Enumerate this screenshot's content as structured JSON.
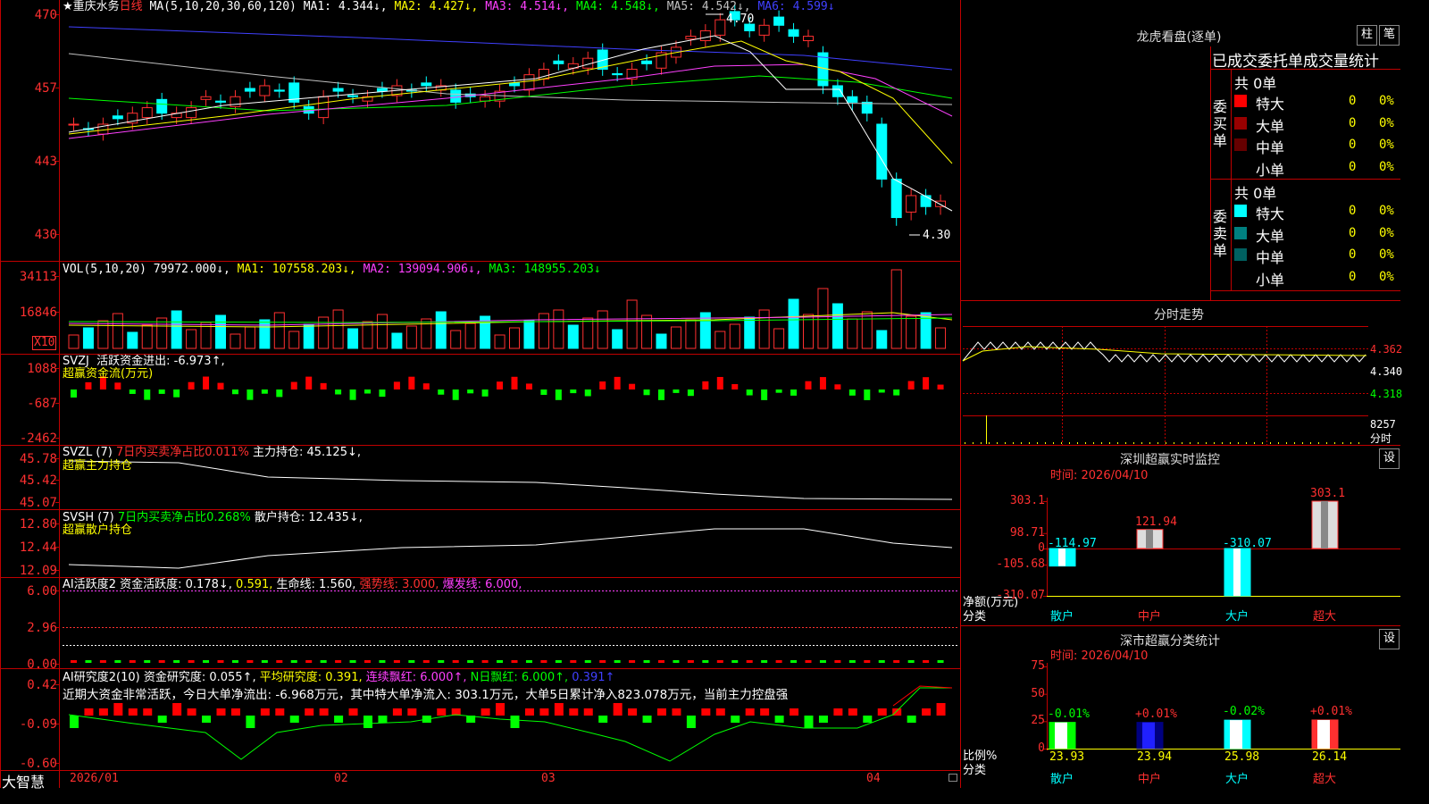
{
  "stock": {
    "title": "★重庆水务",
    "period": "日线"
  },
  "main": {
    "ma_params": "MA(5,10,20,30,60,120)",
    "ma": [
      {
        "label": "MA1: 4.344↓,",
        "color": "#ffffff"
      },
      {
        "label": "MA2: 4.427↓,",
        "color": "#ffff00"
      },
      {
        "label": "MA3: 4.514↓,",
        "color": "#ff40ff"
      },
      {
        "label": "MA4: 4.548↓,",
        "color": "#00ff00"
      },
      {
        "label": "MA5: 4.542↓,",
        "color": "#c0c0c0"
      },
      {
        "label": "MA6: 4.599↓",
        "color": "#4040ff"
      }
    ],
    "y_labels": [
      "470",
      "457",
      "443",
      "430"
    ],
    "high_note": "4.70",
    "low_note": "4.30"
  },
  "vol": {
    "header": "VOL(5,10,20)",
    "value": "79972.000↓,",
    "ma1": "MA1: 107558.203↓,",
    "ma2": "MA2: 139094.906↓,",
    "ma3": "MA3: 148955.203↓",
    "y_labels": [
      "34113",
      "16846"
    ],
    "unit": "X10"
  },
  "svzj": {
    "header": "SVZJ",
    "label": "活跃资金进出: -6.973↑,",
    "sub": "超赢资金流(万元)",
    "y_labels": [
      "1088",
      "-687",
      "-2462"
    ]
  },
  "svzl": {
    "header": "SVZL (7)",
    "label1": "7日内买卖净占比0.011%",
    "label2": "主力持仓: 45.125↓,",
    "sub": "超赢主力持仓",
    "y_labels": [
      "45.78",
      "45.42",
      "45.07"
    ]
  },
  "svsh": {
    "header": "SVSH (7)",
    "label1": "7日内买卖净占比0.268%",
    "label2": "散户持仓: 12.435↓,",
    "sub": "超赢散户持仓",
    "y_labels": [
      "12.80",
      "12.44",
      "12.09"
    ]
  },
  "ai1": {
    "header": "AI活跃度2",
    "a": "资金活跃度: 0.178↓,",
    "b": "0.591,",
    "c": "生命线: 1.560,",
    "d": "强势线: 3.000,",
    "e": "爆发线: 6.000,",
    "y_labels": [
      "6.00",
      "2.96",
      "0.00"
    ]
  },
  "ai2": {
    "header": "AI研究度2(10)",
    "a": "资金研究度: 0.055↑,",
    "b": "平均研究度: 0.391,",
    "c": "连续飘红: 6.000↑,",
    "d": "N日飘红: 6.000↑,",
    "e": "0.391↑",
    "comment": "近期大资金非常活跃，今日大单净流出: -6.968万元，其中特大单净流入: 303.1万元，大单5日累计净入823.078万元，当前主力控盘强",
    "y_labels": [
      "0.42",
      "-0.09",
      "-0.60"
    ]
  },
  "footer": {
    "brand": "大智慧",
    "dates": [
      "2026/01",
      "02",
      "03",
      "04"
    ]
  },
  "dragon": {
    "title": "龙虎看盘(逐单)",
    "btn1": "柱",
    "btn2": "笔",
    "subtitle": "已成交委托单成交量统计",
    "buy_total": "共 0单",
    "sell_total": "共 0单",
    "buy_label": "委买单",
    "sell_label": "委卖单",
    "buy_rows": [
      {
        "name": "特大",
        "count": "0",
        "pct": "0%",
        "color": "#ff0000"
      },
      {
        "name": "大单",
        "count": "0",
        "pct": "0%",
        "color": "#990000"
      },
      {
        "name": "中单",
        "count": "0",
        "pct": "0%",
        "color": "#660000"
      },
      {
        "name": "小单",
        "count": "0",
        "pct": "0%",
        "color": "#000000"
      }
    ],
    "sell_rows": [
      {
        "name": "特大",
        "count": "0",
        "pct": "0%",
        "color": "#00ffff"
      },
      {
        "name": "大单",
        "count": "0",
        "pct": "0%",
        "color": "#008080"
      },
      {
        "name": "中单",
        "count": "0",
        "pct": "0%",
        "color": "#006060"
      },
      {
        "name": "小单",
        "count": "0",
        "pct": "0%",
        "color": "#000000"
      }
    ]
  },
  "intraday": {
    "title": "分时走势",
    "price_labels": [
      "4.362",
      "4.340",
      "4.318"
    ],
    "vol_label": "8257",
    "bottom_label": "分时"
  },
  "monitor": {
    "title": "深圳超赢实时监控",
    "btn": "设",
    "time": "时间: 2026/04/10",
    "y_labels": [
      "303.1",
      "98.71",
      "0",
      "-105.68",
      "-310.07"
    ],
    "unit": "净额(万元)",
    "cat_label": "分类",
    "categories": [
      "散户",
      "中户",
      "大户",
      "超大"
    ],
    "values": [
      "-114.97",
      "121.94",
      "-310.07",
      "303.1"
    ],
    "value_colors": [
      "#00ffff",
      "#ff3030",
      "#00ffff",
      "#ff3030"
    ]
  },
  "classify": {
    "title": "深市超赢分类统计",
    "btn": "设",
    "time": "时间: 2026/04/10",
    "y_labels": [
      "75",
      "50",
      "25",
      "0"
    ],
    "unit": "比例%",
    "cat_label": "分类",
    "categories": [
      "散户",
      "中户",
      "大户",
      "超大"
    ],
    "deltas": [
      "-0.01%",
      "+0.01%",
      "-0.02%",
      "+0.01%"
    ],
    "delta_colors": [
      "#00ff00",
      "#ff3030",
      "#00ff00",
      "#ff3030"
    ],
    "values": [
      "23.93",
      "23.94",
      "25.98",
      "26.14"
    ]
  },
  "chart_data": [
    {
      "type": "bar",
      "title": "深圳超赢实时监控",
      "ylabel": "净额(万元)",
      "categories": [
        "散户",
        "中户",
        "大户",
        "超大"
      ],
      "values": [
        -114.97,
        121.94,
        -310.07,
        303.1
      ],
      "ylim": [
        -310.07,
        303.1
      ]
    },
    {
      "type": "bar",
      "title": "深市超赢分类统计",
      "ylabel": "比例%",
      "categories": [
        "散户",
        "中户",
        "大户",
        "超大"
      ],
      "values": [
        23.93,
        23.94,
        25.98,
        26.14
      ],
      "ylim": [
        0,
        75
      ]
    }
  ]
}
